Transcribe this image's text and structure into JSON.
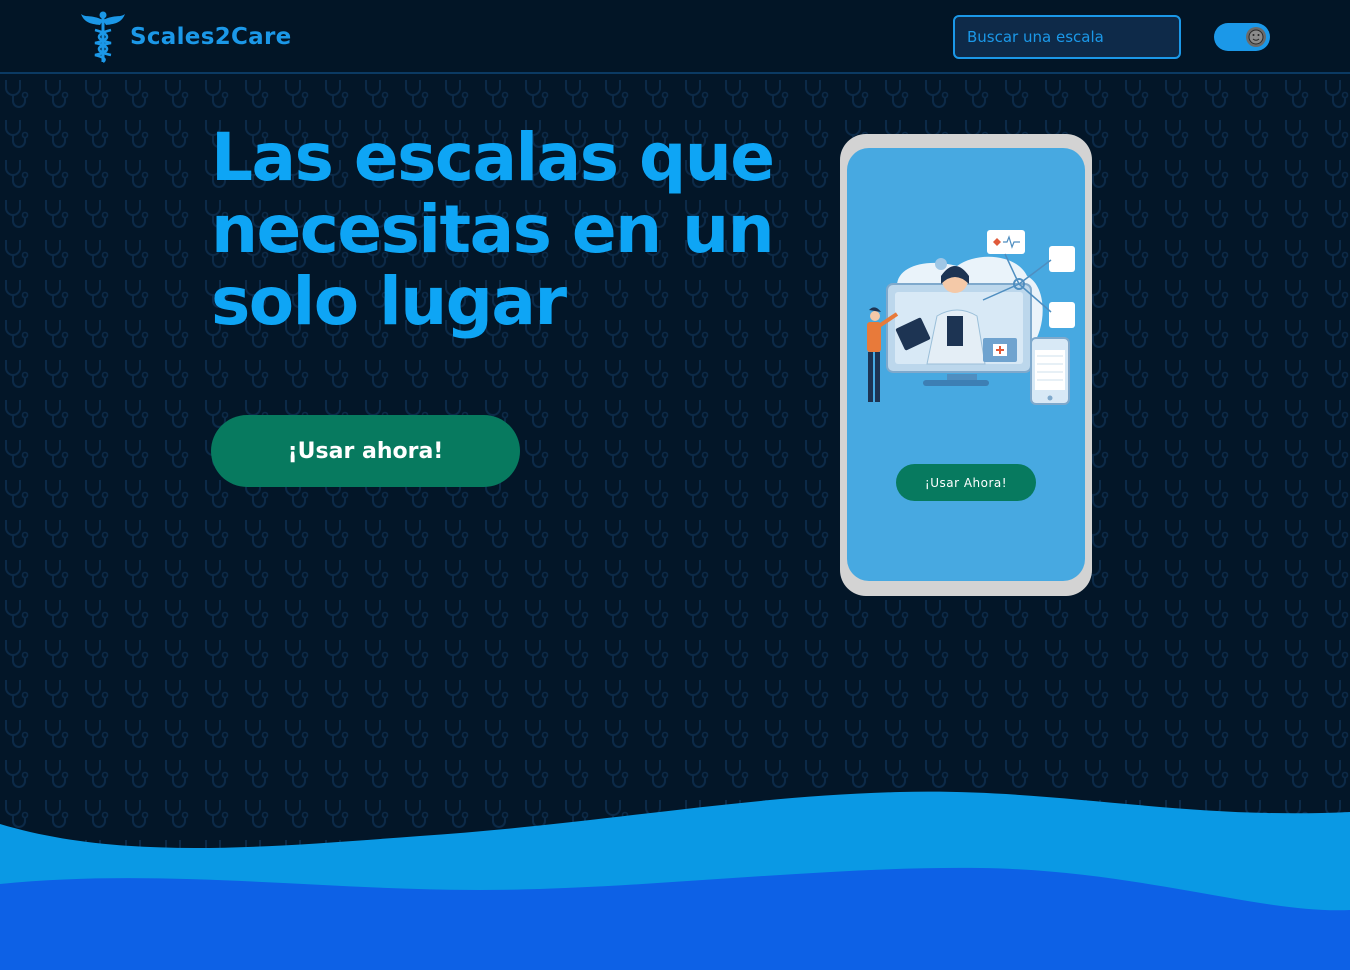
{
  "header": {
    "brand": "Scales2Care",
    "search_placeholder": "Buscar una escala",
    "theme_toggle_icon": "moon-face-icon"
  },
  "hero": {
    "headline": "Las escalas que necesitas en un solo lugar",
    "cta_label": "¡Usar ahora!"
  },
  "phone": {
    "cta_label": "¡Usar Ahora!",
    "illustration_icon": "telemedicine-doctor-illustration"
  },
  "colors": {
    "background": "#031628",
    "accent": "#0ea5f5",
    "button": "#077a5f",
    "wave_light": "#0a99e4",
    "wave_dark": "#0d61e6"
  }
}
